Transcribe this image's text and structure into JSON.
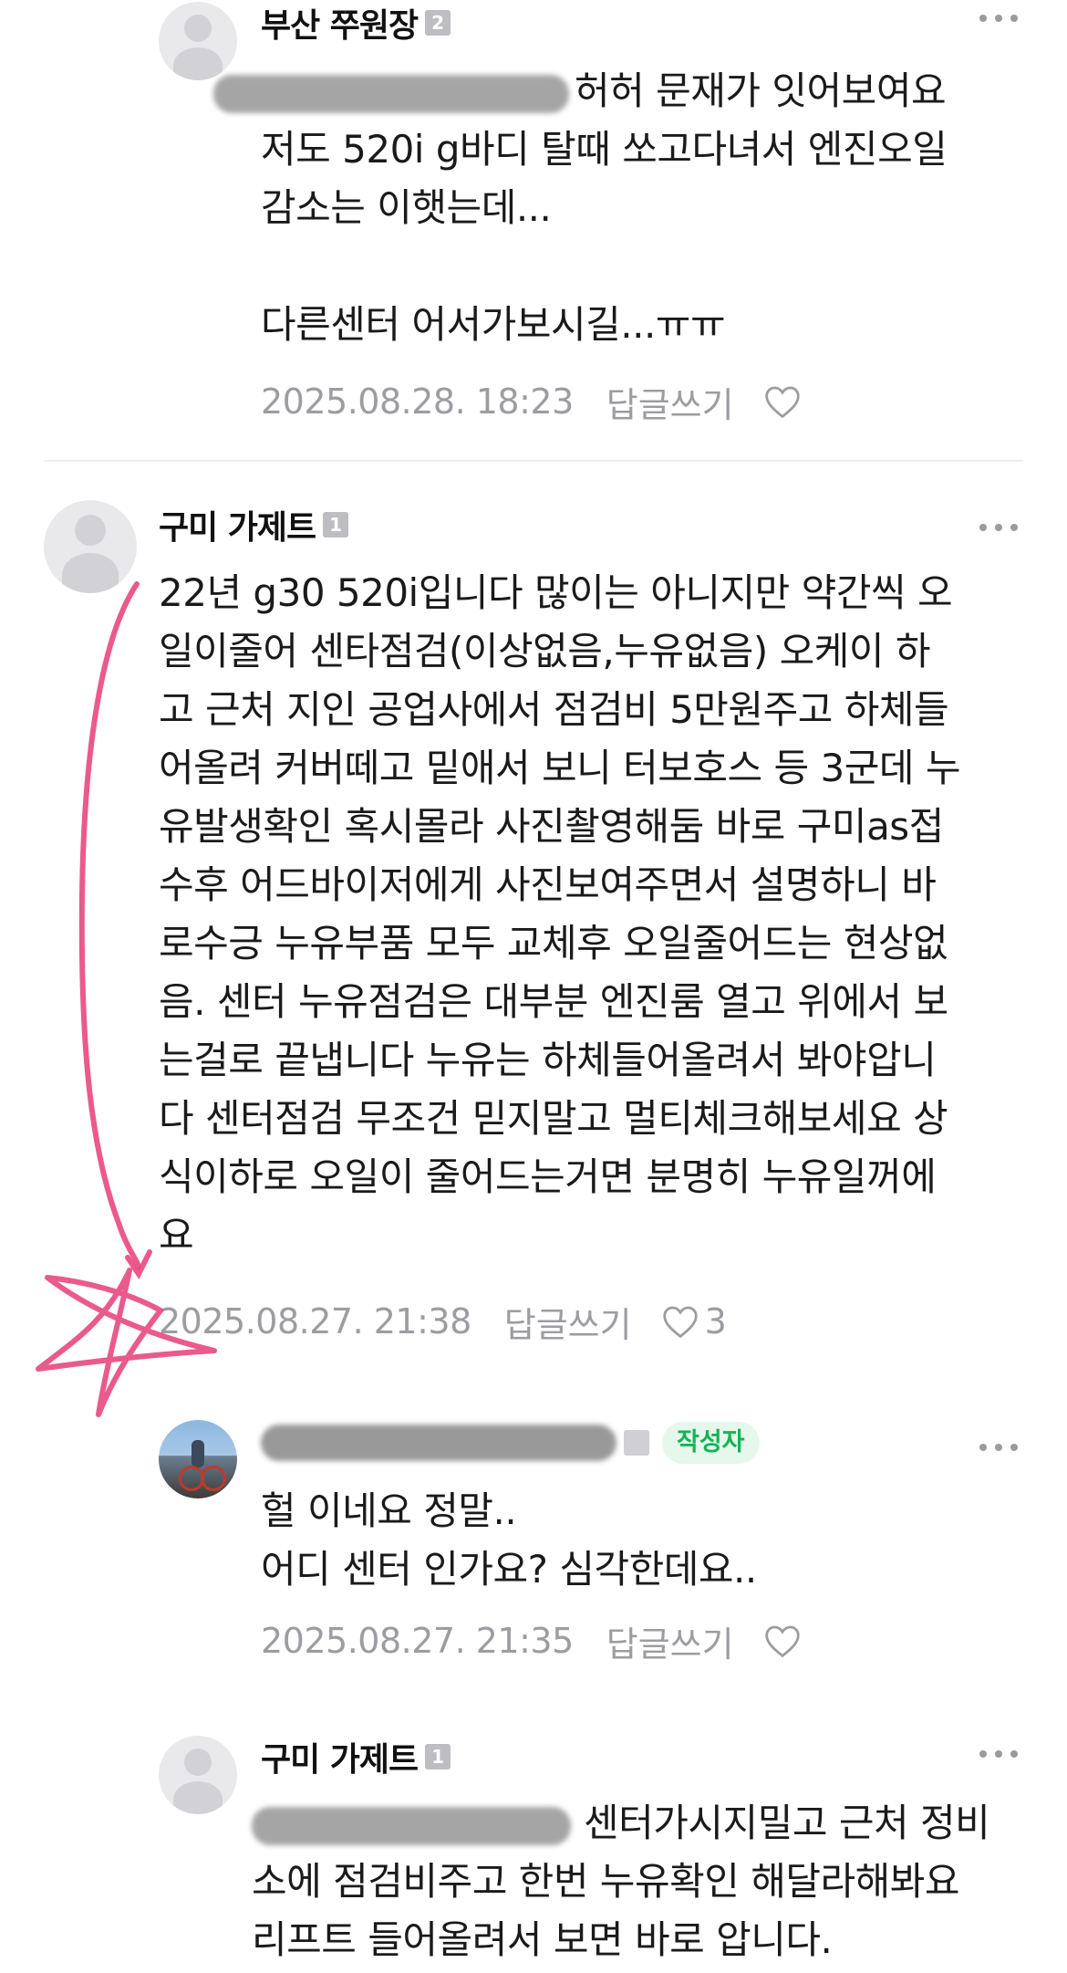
{
  "comments": [
    {
      "nickname": "부산 쭈원장",
      "level": "2",
      "body_after_mention": "허허 문재가 잇어보여요",
      "body_rest": "저도 520i g바디 탈때 쏘고다녀서 엔진오일\n감소는 이햇는데...\n\n다른센터 어서가보시길...ㅠㅠ",
      "date": "2025.08.28. 18:23",
      "reply_label": "답글쓰기",
      "like_count": "",
      "avatar_icon": "default-profile-icon"
    },
    {
      "nickname": "구미 가제트",
      "level": "1",
      "body": "22년 g30 520i입니다 많이는 아니지만 약간씩 오\n일이줄어 센타점검(이상없음,누유없음) 오케이 하\n고 근처 지인 공업사에서 점검비 5만원주고 하체들\n어올려 커버떼고 밑애서 보니 터보호스 등 3군데 누\n유발생확인 혹시몰라 사진촬영해둠 바로 구미as접\n수후 어드바이저에게 사진보여주면서 설명하니 바\n로수긍 누유부품 모두 교체후 오일줄어드는 현상없\n음. 센터 누유점검은 대부분 엔진룸 열고 위에서 보\n는걸로 끝냅니다 누유는 하체들어올려서 봐야압니\n다 센터점검 무조건 믿지말고 멀티체크해보세요 상\n식이하로 오일이 줄어드는거면 분명히 누유일꺼에\n요",
      "date": "2025.08.27. 21:38",
      "reply_label": "답글쓰기",
      "like_count": "3",
      "avatar_icon": "default-profile-icon"
    },
    {
      "badge": "작성자",
      "body": "헐 이네요 정말..\n어디 센터 인가요? 심각한데요..",
      "date": "2025.08.27. 21:35",
      "reply_label": "답글쓰기",
      "like_count": "",
      "avatar_icon": "photo-avatar"
    },
    {
      "nickname": "구미 가제트",
      "level": "1",
      "body_after_mention": "센터가시지밀고 근처 정비",
      "body_rest": "소에 점검비주고 한번 누유확인 해달라해봐요\n리프트 들어올려서 보면 바로 압니다.",
      "avatar_icon": "default-profile-icon"
    }
  ],
  "icons": {
    "more": "more-dots-icon",
    "like": "heart-icon"
  },
  "colors": {
    "text": "#1a1a1a",
    "meta": "#9c9ca2",
    "author_badge_bg": "#e6f7ec",
    "author_badge_text": "#14b454",
    "scribble": "#e8487f"
  }
}
